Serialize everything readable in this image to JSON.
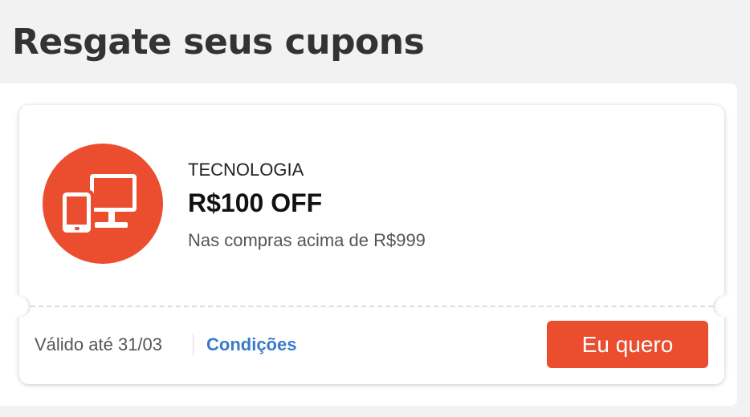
{
  "page": {
    "title": "Resgate seus cupons"
  },
  "coupon": {
    "category": "TECNOLOGIA",
    "value": "R$100 OFF",
    "condition": "Nas compras acima de R$999",
    "validity": "Válido até 31/03",
    "conditions_link": "Condições",
    "cta_label": "Eu quero",
    "icon": "devices-icon"
  },
  "colors": {
    "accent": "#ea4e2f",
    "link": "#3a7bc8",
    "background": "#f2f2f2",
    "title": "#333333"
  }
}
